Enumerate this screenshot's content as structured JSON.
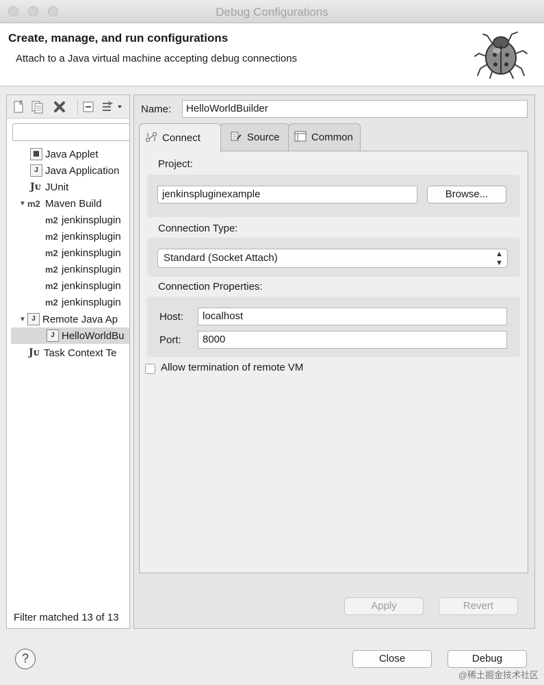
{
  "window": {
    "title": "Debug Configurations"
  },
  "header": {
    "title": "Create, manage, and run configurations",
    "description": "Attach to a Java virtual machine accepting debug connections"
  },
  "sidebar": {
    "filter_placeholder": "",
    "items": [
      {
        "label": "Java Applet",
        "icon": "java-applet-icon"
      },
      {
        "label": "Java Application",
        "icon": "java-application-icon"
      },
      {
        "label": "JUnit",
        "icon": "junit-icon"
      },
      {
        "label": "Maven Build",
        "icon": "maven-icon",
        "expanded": true
      },
      {
        "label": "jenkinsplugin",
        "icon": "maven-icon"
      },
      {
        "label": "jenkinsplugin",
        "icon": "maven-icon"
      },
      {
        "label": "jenkinsplugin",
        "icon": "maven-icon"
      },
      {
        "label": "jenkinsplugin",
        "icon": "maven-icon"
      },
      {
        "label": "jenkinsplugin",
        "icon": "maven-icon"
      },
      {
        "label": "jenkinsplugin",
        "icon": "maven-icon"
      },
      {
        "label": "Remote Java Ap",
        "icon": "remote-java-icon",
        "expanded": true
      },
      {
        "label": "HelloWorldBu",
        "icon": "remote-java-icon",
        "selected": true
      },
      {
        "label": "Task Context Te",
        "icon": "junit-icon"
      }
    ],
    "filter_status": "Filter matched 13 of 13"
  },
  "config": {
    "name_label": "Name:",
    "name_value": "HelloWorldBuilder",
    "tabs": [
      {
        "label": "Connect",
        "icon": "connect-icon",
        "active": true
      },
      {
        "label": "Source",
        "icon": "source-icon",
        "active": false
      },
      {
        "label": "Common",
        "icon": "common-icon",
        "active": false
      }
    ],
    "project_label": "Project:",
    "project_value": "jenkinspluginexample",
    "browse_label": "Browse...",
    "connection_type_label": "Connection Type:",
    "connection_type_value": "Standard (Socket Attach)",
    "connection_props_label": "Connection Properties:",
    "host_label": "Host:",
    "host_value": "localhost",
    "port_label": "Port:",
    "port_value": "8000",
    "allow_termination_label": "Allow termination of remote VM",
    "allow_termination_checked": false,
    "apply_label": "Apply",
    "revert_label": "Revert"
  },
  "footer": {
    "help_icon": "help-icon",
    "help_glyph": "?",
    "close_label": "Close",
    "debug_label": "Debug"
  },
  "watermark": "@稀土掘金技术社区"
}
